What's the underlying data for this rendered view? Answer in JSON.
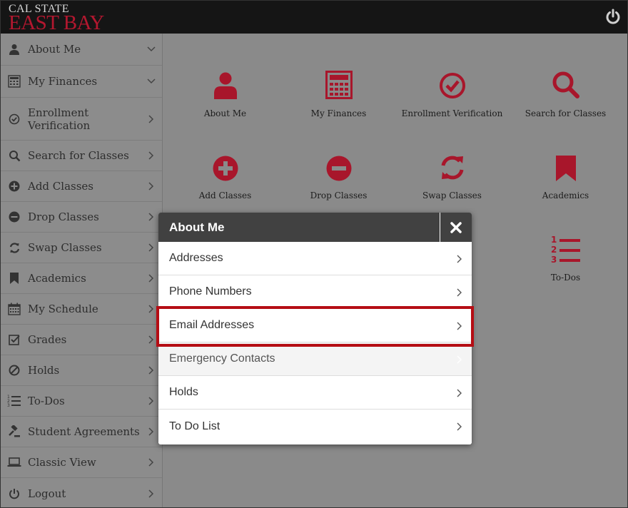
{
  "header": {
    "logo_line1": "CAL STATE",
    "logo_line2": "EAST BAY",
    "power_icon": "power-icon"
  },
  "colors": {
    "accent": "#a8162b",
    "header_bg": "#151515",
    "modal_header": "#414141",
    "highlight": "#b50d14"
  },
  "sidebar": {
    "items": [
      {
        "label": "About Me",
        "icon": "user-icon",
        "chevron": "down"
      },
      {
        "label": "My Finances",
        "icon": "calculator-icon",
        "chevron": "down"
      },
      {
        "label": "Enrollment Verification",
        "icon": "check-circle-icon",
        "chevron": "right"
      },
      {
        "label": "Search for Classes",
        "icon": "search-icon",
        "chevron": "right"
      },
      {
        "label": "Add Classes",
        "icon": "plus-circle-icon",
        "chevron": "right"
      },
      {
        "label": "Drop Classes",
        "icon": "minus-circle-icon",
        "chevron": "right"
      },
      {
        "label": "Swap Classes",
        "icon": "refresh-icon",
        "chevron": "right"
      },
      {
        "label": "Academics",
        "icon": "bookmark-icon",
        "chevron": "right"
      },
      {
        "label": "My Schedule",
        "icon": "calendar-icon",
        "chevron": "right"
      },
      {
        "label": "Grades",
        "icon": "checkbox-icon",
        "chevron": "right"
      },
      {
        "label": "Holds",
        "icon": "ban-icon",
        "chevron": "right"
      },
      {
        "label": "To-Dos",
        "icon": "numbered-list-icon",
        "chevron": "right"
      },
      {
        "label": "Student Agreements",
        "icon": "gavel-icon",
        "chevron": "right"
      },
      {
        "label": "Classic View",
        "icon": "laptop-icon",
        "chevron": "right"
      },
      {
        "label": "Logout",
        "icon": "power-icon",
        "chevron": "right"
      }
    ]
  },
  "tiles": [
    {
      "label": "About Me",
      "icon": "user-icon"
    },
    {
      "label": "My Finances",
      "icon": "calculator-icon"
    },
    {
      "label": "Enrollment Verification",
      "icon": "check-circle-icon"
    },
    {
      "label": "Search for Classes",
      "icon": "search-icon"
    },
    {
      "label": "Add Classes",
      "icon": "plus-circle-icon"
    },
    {
      "label": "Drop Classes",
      "icon": "minus-circle-icon"
    },
    {
      "label": "Swap Classes",
      "icon": "refresh-icon"
    },
    {
      "label": "Academics",
      "icon": "bookmark-icon"
    },
    {
      "label": "To-Dos",
      "icon": "numbered-list-icon"
    }
  ],
  "modal": {
    "title": "About Me",
    "close_icon": "close-icon",
    "items": [
      {
        "label": "Addresses"
      },
      {
        "label": "Phone Numbers"
      },
      {
        "label": "Email Addresses"
      },
      {
        "label": "Emergency Contacts"
      },
      {
        "label": "Holds"
      },
      {
        "label": "To Do List"
      }
    ]
  }
}
